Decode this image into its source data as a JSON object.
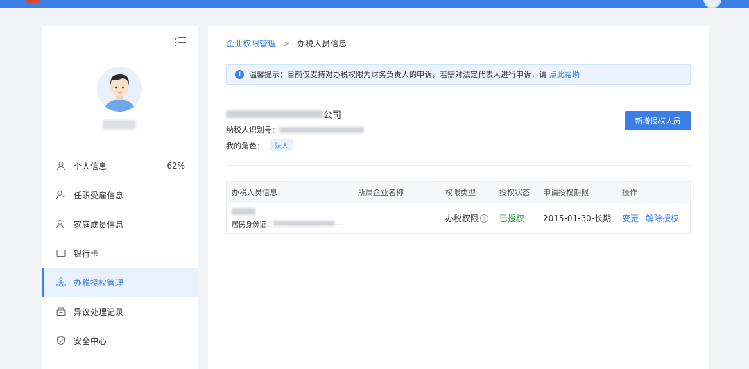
{
  "sidebar": {
    "user_pct": "62%",
    "items": [
      {
        "label": "个人信息",
        "icon": "user-icon",
        "pct": "62%"
      },
      {
        "label": "任职受雇信息",
        "icon": "user-list-icon"
      },
      {
        "label": "家庭成员信息",
        "icon": "family-icon"
      },
      {
        "label": "银行卡",
        "icon": "bank-card-icon"
      },
      {
        "label": "办税授权管理",
        "icon": "org-chart-icon",
        "active": true
      },
      {
        "label": "异议处理记录",
        "icon": "inbox-icon"
      },
      {
        "label": "安全中心",
        "icon": "shield-icon"
      }
    ]
  },
  "breadcrumb": {
    "parent": "企业权限管理",
    "separator": ">",
    "current": "办税人员信息"
  },
  "tip": {
    "icon_glyph": "i",
    "text": "温馨提示：目前仅支持对办税权限为财务负责人的申诉，若需对法定代表人进行申诉，请",
    "link": "点此帮助"
  },
  "company": {
    "name_suffix": "公司",
    "taxid_label": "纳税人识别号：",
    "role_label": "我的角色：",
    "role_value": "法人"
  },
  "add_button": "新增授权人员",
  "table": {
    "headers": [
      "办税人员信息",
      "所属企业名称",
      "权限类型",
      "授权状态",
      "申请授权期限",
      "操作"
    ],
    "rows": [
      {
        "id_label": "居民身份证：",
        "id_ellipsis": "...",
        "company": "",
        "permission": "办税权限",
        "info_glyph": "i",
        "status": "已授权",
        "period": "2015-01-30-长期",
        "actions": [
          "变更",
          "解除授权"
        ]
      }
    ]
  },
  "colors": {
    "primary": "#3b7ee6",
    "success": "#2fa24b",
    "background": "#f2f3f5"
  }
}
